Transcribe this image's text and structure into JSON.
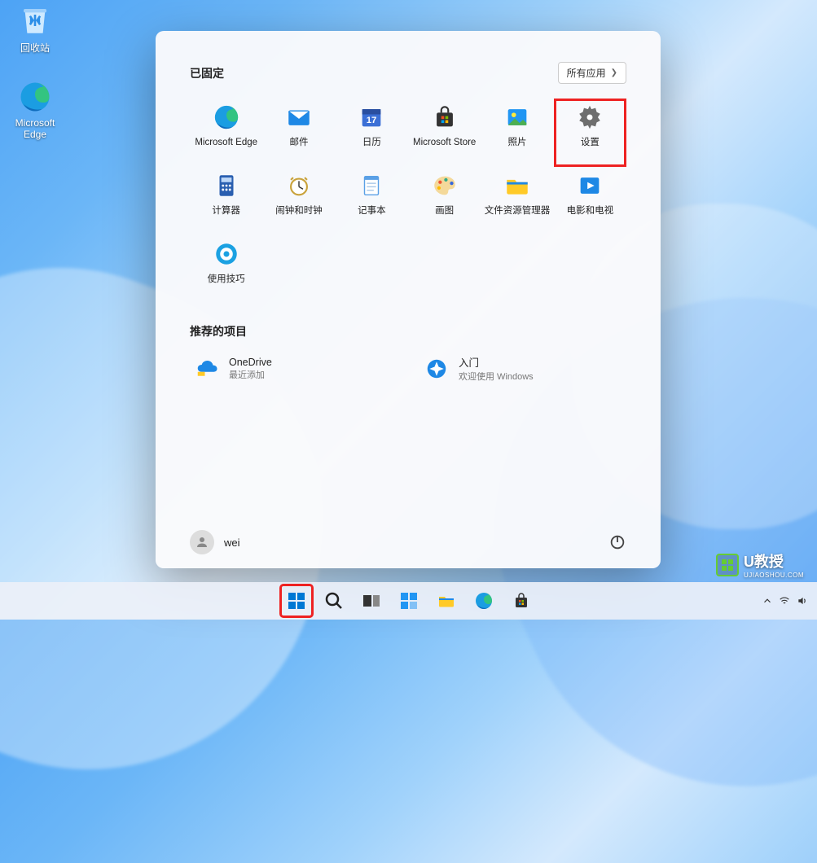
{
  "desktop": {
    "icons": [
      {
        "id": "recycle-bin",
        "label": "回收站"
      },
      {
        "id": "edge",
        "label": "Microsoft Edge"
      }
    ]
  },
  "start_menu": {
    "pinned_header": "已固定",
    "all_apps_label": "所有应用",
    "pinned": [
      {
        "id": "edge",
        "label": "Microsoft Edge"
      },
      {
        "id": "mail",
        "label": "邮件"
      },
      {
        "id": "calendar",
        "label": "日历"
      },
      {
        "id": "store",
        "label": "Microsoft Store"
      },
      {
        "id": "photos",
        "label": "照片"
      },
      {
        "id": "settings",
        "label": "设置",
        "highlight": true
      },
      {
        "id": "calculator",
        "label": "计算器"
      },
      {
        "id": "clock",
        "label": "闹钟和时钟"
      },
      {
        "id": "notepad",
        "label": "记事本"
      },
      {
        "id": "paint",
        "label": "画图"
      },
      {
        "id": "explorer",
        "label": "文件资源管理器"
      },
      {
        "id": "movies",
        "label": "电影和电视"
      },
      {
        "id": "tips",
        "label": "使用技巧"
      }
    ],
    "recommended_header": "推荐的项目",
    "recommended": [
      {
        "id": "onedrive",
        "title": "OneDrive",
        "subtitle": "最近添加"
      },
      {
        "id": "getstarted",
        "title": "入门",
        "subtitle": "欢迎使用 Windows"
      }
    ],
    "user_name": "wei"
  },
  "taskbar": {
    "items": [
      {
        "id": "start",
        "highlight": true
      },
      {
        "id": "search"
      },
      {
        "id": "taskview"
      },
      {
        "id": "widgets"
      },
      {
        "id": "explorer"
      },
      {
        "id": "edge"
      },
      {
        "id": "store"
      }
    ]
  },
  "watermark": {
    "brand": "U教授",
    "sub": "UJIAOSHOU.COM"
  }
}
